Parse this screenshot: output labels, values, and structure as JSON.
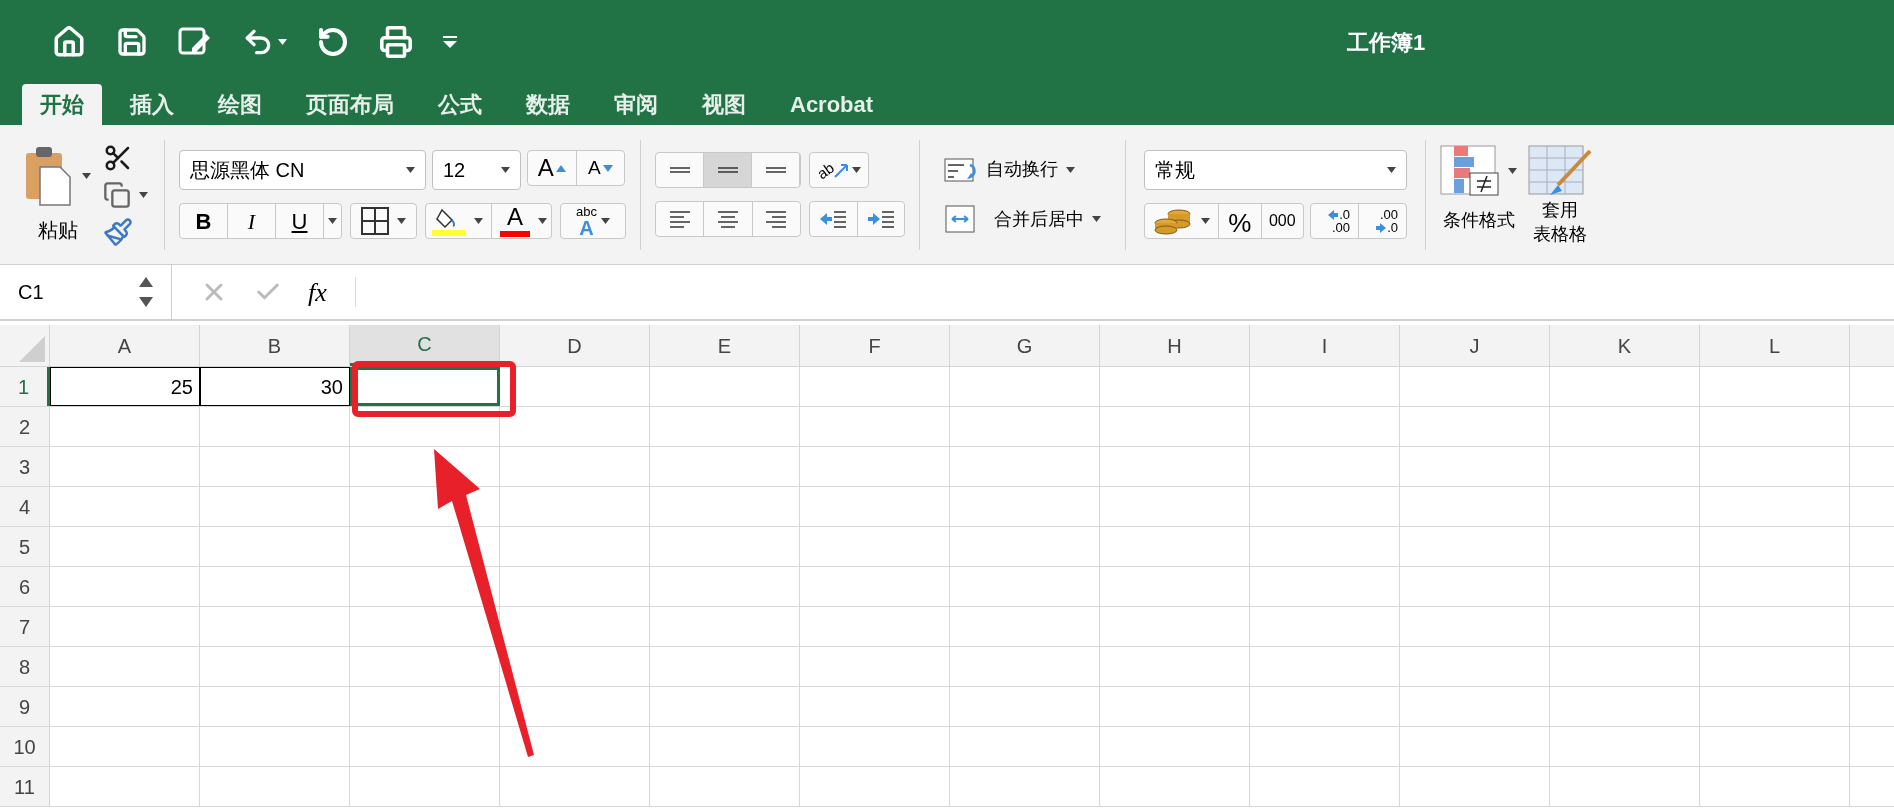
{
  "title_bar": {
    "title": "工作簿1"
  },
  "tabs": [
    {
      "label": "开始",
      "selected": true
    },
    {
      "label": "插入",
      "selected": false
    },
    {
      "label": "绘图",
      "selected": false
    },
    {
      "label": "页面布局",
      "selected": false
    },
    {
      "label": "公式",
      "selected": false
    },
    {
      "label": "数据",
      "selected": false
    },
    {
      "label": "审阅",
      "selected": false
    },
    {
      "label": "视图",
      "selected": false
    },
    {
      "label": "Acrobat",
      "selected": false
    }
  ],
  "ribbon": {
    "paste_label": "粘贴",
    "font_name": "思源黑体 CN",
    "font_size": "12",
    "grow_font": "A",
    "shrink_font": "A",
    "style_buttons": [
      "B",
      "I",
      "U"
    ],
    "font_color_letter": "A",
    "phonetic": [
      "abc",
      "A"
    ],
    "orientation_label": "ab",
    "vertical_align": [
      {
        "selected": false
      },
      {
        "selected": true
      },
      {
        "selected": false
      }
    ],
    "wrap_text": "自动换行",
    "merge_center": "合并后居中",
    "number_format": "常规",
    "percent": "%",
    "thousands": "000",
    "increase_decimal": [
      ".0",
      ".00"
    ],
    "decrease_decimal": [
      ".00",
      ".0"
    ],
    "conditional_format": "条件格式",
    "format_table": [
      "套用",
      "表格格"
    ]
  },
  "formula_bar": {
    "name_box": "C1",
    "fx": "fx"
  },
  "sheet": {
    "columns": [
      {
        "label": "A",
        "selected": false
      },
      {
        "label": "B",
        "selected": false
      },
      {
        "label": "C",
        "selected": true
      },
      {
        "label": "D",
        "selected": false
      },
      {
        "label": "E",
        "selected": false
      },
      {
        "label": "F",
        "selected": false
      },
      {
        "label": "G",
        "selected": false
      },
      {
        "label": "H",
        "selected": false
      },
      {
        "label": "I",
        "selected": false
      },
      {
        "label": "J",
        "selected": false
      },
      {
        "label": "K",
        "selected": false
      },
      {
        "label": "L",
        "selected": false
      }
    ],
    "rows": [
      {
        "label": "1",
        "selected": true,
        "cells": [
          {
            "value": "25",
            "bordered": true
          },
          {
            "value": "30",
            "bordered": true
          }
        ]
      },
      {
        "label": "2",
        "selected": false
      },
      {
        "label": "3",
        "selected": false
      },
      {
        "label": "4",
        "selected": false
      },
      {
        "label": "5",
        "selected": false
      },
      {
        "label": "6",
        "selected": false
      },
      {
        "label": "7",
        "selected": false
      },
      {
        "label": "8",
        "selected": false
      },
      {
        "label": "9",
        "selected": false
      },
      {
        "label": "10",
        "selected": false
      },
      {
        "label": "11",
        "selected": false
      }
    ]
  }
}
